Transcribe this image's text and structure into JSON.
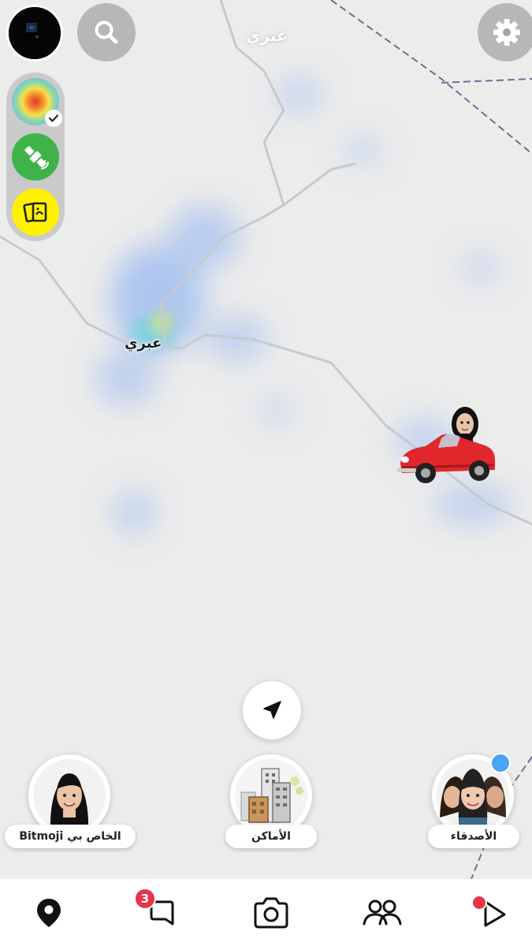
{
  "map": {
    "top_place_label": "عبري",
    "city_label": "عبري"
  },
  "header": {
    "search_icon": "search-icon",
    "settings_icon": "gear-icon"
  },
  "layers": [
    {
      "name": "heatmap",
      "icon": "heatmap-icon",
      "selected": true
    },
    {
      "name": "satellite",
      "icon": "satellite-icon",
      "selected": false
    },
    {
      "name": "memories",
      "icon": "memories-cards-icon",
      "selected": false
    }
  ],
  "tiles": {
    "bitmoji_label": "Bitmoji الخاص بي",
    "places_label": "الأماكن",
    "friends_label": "الأصدقاء"
  },
  "tabbar": {
    "chat_badge": "3",
    "tabs": [
      "map-pin-icon",
      "chat-icon",
      "camera-icon",
      "friends-icon",
      "stories-play-icon"
    ]
  },
  "colors": {
    "accent_red": "#e8354a",
    "layer_green": "#3fb34a",
    "layer_yellow": "#fff200",
    "notify_blue": "#4aa3f5"
  }
}
